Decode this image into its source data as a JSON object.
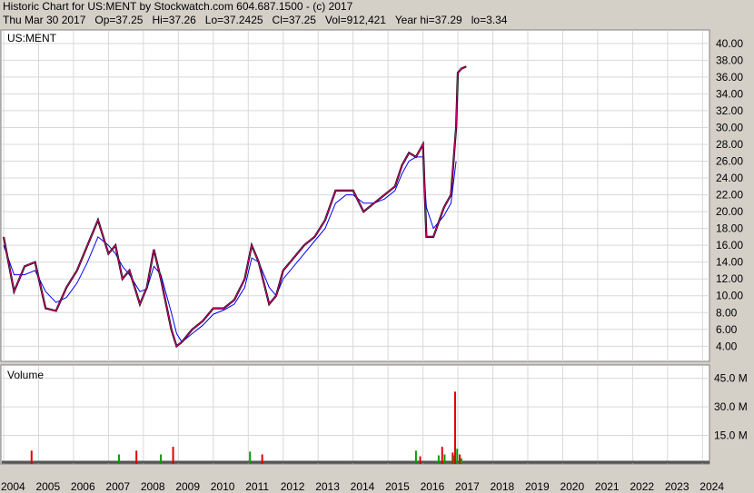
{
  "header": {
    "line1": "Historic Chart for US:MENT by Stockwatch.com 604.687.1500 - (c) 2017",
    "line2": "Thu Mar 30 2017   Op=37.25   Hi=37.26   Lo=37.2425   Cl=37.25   Vol=912,421   Year hi=37.29   lo=3.34"
  },
  "chart_data": [
    {
      "type": "line",
      "title": "US:MENT",
      "grid": true,
      "ylim": [
        2.2,
        41.6
      ],
      "y_ticks": [
        "40.00",
        "38.00",
        "36.00",
        "34.00",
        "32.00",
        "30.00",
        "28.00",
        "26.00",
        "24.00",
        "22.00",
        "20.00",
        "18.00",
        "16.00",
        "14.00",
        "12.00",
        "10.00",
        "8.00",
        "6.00",
        "4.00"
      ],
      "x": [
        2004.0,
        2004.3,
        2004.6,
        2004.9,
        2005.2,
        2005.5,
        2005.8,
        2006.1,
        2006.4,
        2006.7,
        2007.0,
        2007.2,
        2007.4,
        2007.6,
        2007.9,
        2008.1,
        2008.3,
        2008.5,
        2008.8,
        2008.95,
        2009.1,
        2009.4,
        2009.7,
        2010.0,
        2010.3,
        2010.6,
        2010.9,
        2011.1,
        2011.3,
        2011.6,
        2011.8,
        2012.0,
        2012.3,
        2012.6,
        2012.9,
        2013.2,
        2013.5,
        2013.8,
        2014.0,
        2014.3,
        2014.6,
        2014.9,
        2015.2,
        2015.4,
        2015.6,
        2015.8,
        2016.0,
        2016.1,
        2016.3,
        2016.6,
        2016.8,
        2016.95,
        2017.0,
        2017.1,
        2017.24
      ],
      "series": [
        {
          "values": [
            17.0,
            10.5,
            13.5,
            14.0,
            8.5,
            8.2,
            11.0,
            13.0,
            16.0,
            19.0,
            15.0,
            16.0,
            12.0,
            13.0,
            9.0,
            11.0,
            15.5,
            12.0,
            6.0,
            4.0,
            4.5,
            6.0,
            7.0,
            8.5,
            8.5,
            9.5,
            12.0,
            16.0,
            14.0,
            9.0,
            10.0,
            13.0,
            14.5,
            16.0,
            17.0,
            19.0,
            22.5,
            22.5,
            22.5,
            20.0,
            21.0,
            22.0,
            23.0,
            25.5,
            27.0,
            26.5,
            28.0,
            17.0,
            17.0,
            20.5,
            22.0,
            30.0,
            36.5,
            37.0,
            37.25
          ]
        },
        {
          "values": [
            16.0,
            12.5,
            12.5,
            13.0,
            10.5,
            9.2,
            9.8,
            11.5,
            14.0,
            17.0,
            16.0,
            15.0,
            13.5,
            12.5,
            10.5,
            10.8,
            13.5,
            12.5,
            8.0,
            5.5,
            4.5,
            5.5,
            6.5,
            7.8,
            8.3,
            9.0,
            11.0,
            14.5,
            14.0,
            11.0,
            10.0,
            12.0,
            13.5,
            15.0,
            16.5,
            18.0,
            21.0,
            22.0,
            22.0,
            21.0,
            21.0,
            21.5,
            22.5,
            24.5,
            26.0,
            26.5,
            26.5,
            20.5,
            18.0,
            19.5,
            21.0,
            26.0
          ]
        }
      ]
    },
    {
      "type": "bar",
      "title": "Volume",
      "ylim": [
        0,
        52
      ],
      "y_ticks": [
        "45.0 M",
        "30.0 M",
        "15.0 M"
      ],
      "highlights": [
        {
          "x": 2004.8,
          "value": 7.0
        },
        {
          "x": 2007.3,
          "value": 5.0
        },
        {
          "x": 2007.8,
          "value": 7.0
        },
        {
          "x": 2008.5,
          "value": 5.0
        },
        {
          "x": 2008.85,
          "value": 9.0
        },
        {
          "x": 2011.05,
          "value": 6.5
        },
        {
          "x": 2011.4,
          "value": 5.0
        },
        {
          "x": 2015.8,
          "value": 7.0
        },
        {
          "x": 2015.92,
          "value": 4.0
        },
        {
          "x": 2016.45,
          "value": 4.5
        },
        {
          "x": 2016.55,
          "value": 9.0
        },
        {
          "x": 2016.62,
          "value": 5.0
        },
        {
          "x": 2016.85,
          "value": 6.0
        },
        {
          "x": 2016.88,
          "value": 4.5
        },
        {
          "x": 2016.92,
          "value": 38.0
        },
        {
          "x": 2016.98,
          "value": 8.0
        },
        {
          "x": 2017.05,
          "value": 5.0
        },
        {
          "x": 2017.1,
          "value": 3.0
        }
      ]
    }
  ],
  "x_axis": {
    "xlim": [
      2004.0,
      2024.2
    ],
    "labels": [
      "2004",
      "2005",
      "2006",
      "2007",
      "2008",
      "2009",
      "2010",
      "2011",
      "2012",
      "2013",
      "2014",
      "2015",
      "2016",
      "2017",
      "2018",
      "2019",
      "2020",
      "2021",
      "2022",
      "2023",
      "2024"
    ]
  },
  "colors": {
    "background": "#ffffff",
    "frame": "#d4d0c8",
    "grid": "#d8d8d8",
    "price": "#000000",
    "short_ma": "#e0007c",
    "long_ma": "#0000ff",
    "volume_up": "#00a000",
    "volume_down": "#e00000"
  }
}
